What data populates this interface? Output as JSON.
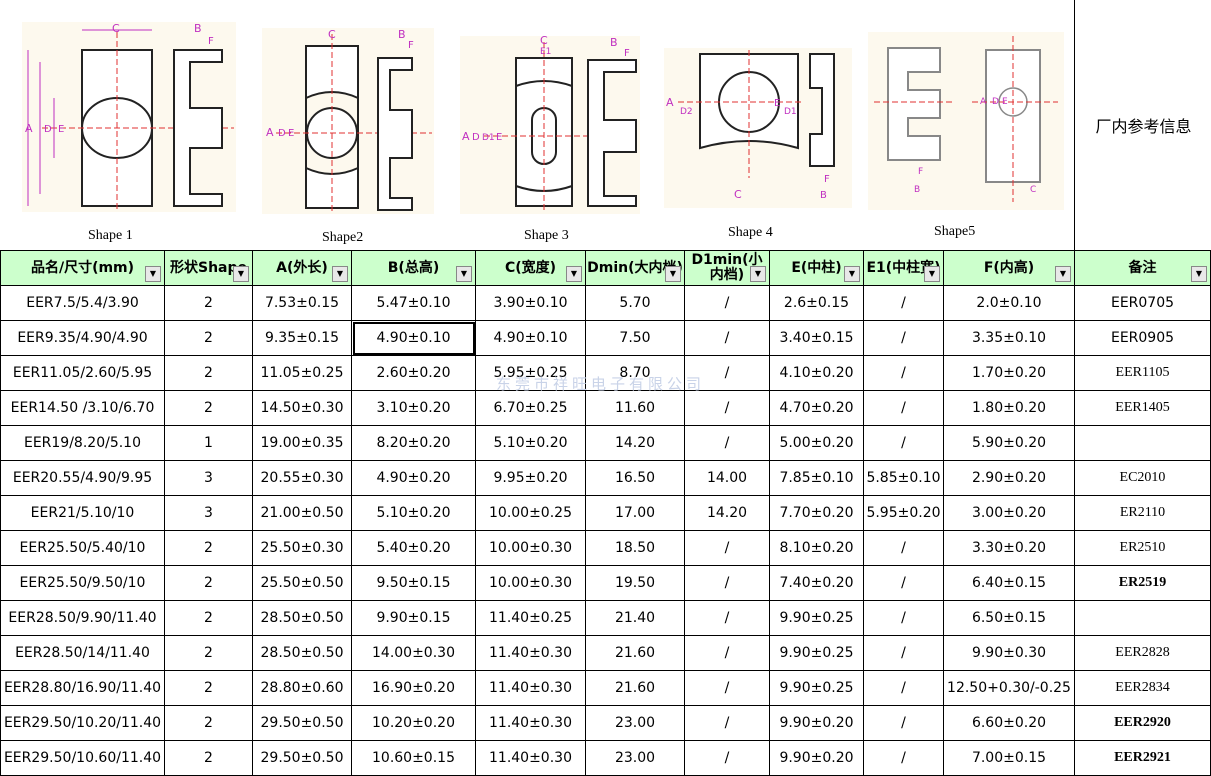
{
  "shapes": [
    {
      "label": "Shape 1",
      "dims": [
        "C",
        "B",
        "F",
        "A",
        "D",
        "E"
      ]
    },
    {
      "label": "Shape2",
      "dims": [
        "C",
        "B",
        "F",
        "A",
        "D",
        "E"
      ]
    },
    {
      "label": "Shape 3",
      "dims": [
        "C",
        "E1",
        "B",
        "F",
        "A",
        "D",
        "D1",
        "E"
      ]
    },
    {
      "label": "Shape 4",
      "dims": [
        "A",
        "D2",
        "E",
        "D1",
        "C",
        "F",
        "B"
      ]
    },
    {
      "label": "Shape5",
      "dims": [
        "A",
        "D",
        "E",
        "F",
        "B",
        "C"
      ]
    }
  ],
  "ref_info": "厂内参考信息",
  "watermark": "东莞市祥旺电子有限公司",
  "columns": [
    "品名/尺寸(mm)",
    "形状Shape",
    "A(外长)",
    "B(总高)",
    "C(宽度)",
    "Dmin(大内档)",
    "D1min(小内档)",
    "E(中柱)",
    "E1(中柱宽)",
    "F(内高)",
    "备注"
  ],
  "rows": [
    [
      "EER7.5/5.4/3.90",
      "2",
      "7.53±0.15",
      "5.47±0.10",
      "3.90±0.10",
      "5.70",
      "/",
      "2.6±0.15",
      "/",
      "2.0±0.10",
      "EER0705"
    ],
    [
      "EER9.35/4.90/4.90",
      "2",
      "9.35±0.15",
      "4.90±0.10",
      "4.90±0.10",
      "7.50",
      "/",
      "3.40±0.15",
      "/",
      "3.35±0.10",
      "EER0905"
    ],
    [
      "EER11.05/2.60/5.95",
      "2",
      "11.05±0.25",
      "2.60±0.20",
      "5.95±0.25",
      "8.70",
      "/",
      "4.10±0.20",
      "/",
      "1.70±0.20",
      "EER1105"
    ],
    [
      "EER14.50 /3.10/6.70",
      "2",
      "14.50±0.30",
      "3.10±0.20",
      "6.70±0.25",
      "11.60",
      "/",
      "4.70±0.20",
      "/",
      "1.80±0.20",
      "EER1405"
    ],
    [
      "EER19/8.20/5.10",
      "1",
      "19.00±0.35",
      "8.20±0.20",
      "5.10±0.20",
      "14.20",
      "/",
      "5.00±0.20",
      "/",
      "5.90±0.20",
      ""
    ],
    [
      "EER20.55/4.90/9.95",
      "3",
      "20.55±0.30",
      "4.90±0.20",
      "9.95±0.20",
      "16.50",
      "14.00",
      "7.85±0.10",
      "5.85±0.10",
      "2.90±0.20",
      "EC2010"
    ],
    [
      "EER21/5.10/10",
      "3",
      "21.00±0.50",
      "5.10±0.20",
      "10.00±0.25",
      "17.00",
      "14.20",
      "7.70±0.20",
      "5.95±0.20",
      "3.00±0.20",
      "ER2110"
    ],
    [
      "EER25.50/5.40/10",
      "2",
      "25.50±0.30",
      "5.40±0.20",
      "10.00±0.30",
      "18.50",
      "/",
      "8.10±0.20",
      "/",
      "3.30±0.20",
      "ER2510"
    ],
    [
      "EER25.50/9.50/10",
      "2",
      "25.50±0.50",
      "9.50±0.15",
      "10.00±0.30",
      "19.50",
      "/",
      "7.40±0.20",
      "/",
      "6.40±0.15",
      "ER2519"
    ],
    [
      "EER28.50/9.90/11.40",
      "2",
      "28.50±0.50",
      "9.90±0.15",
      "11.40±0.25",
      "21.40",
      "/",
      "9.90±0.25",
      "/",
      "6.50±0.15",
      ""
    ],
    [
      "EER28.50/14/11.40",
      "2",
      "28.50±0.50",
      "14.00±0.30",
      "11.40±0.30",
      "21.60",
      "/",
      "9.90±0.25",
      "/",
      "9.90±0.30",
      "EER2828"
    ],
    [
      "EER28.80/16.90/11.40",
      "2",
      "28.80±0.60",
      "16.90±0.20",
      "11.40±0.30",
      "21.60",
      "/",
      "9.90±0.25",
      "/",
      "12.50+0.30/-0.25",
      "EER2834"
    ],
    [
      "EER29.50/10.20/11.40",
      "2",
      "29.50±0.50",
      "10.20±0.20",
      "11.40±0.30",
      "23.00",
      "/",
      "9.90±0.20",
      "/",
      "6.60±0.20",
      "EER2920"
    ],
    [
      "EER29.50/10.60/11.40",
      "2",
      "29.50±0.50",
      "10.60±0.15",
      "11.40±0.30",
      "23.00",
      "/",
      "9.90±0.20",
      "/",
      "7.00±0.15",
      "EER2921"
    ]
  ]
}
